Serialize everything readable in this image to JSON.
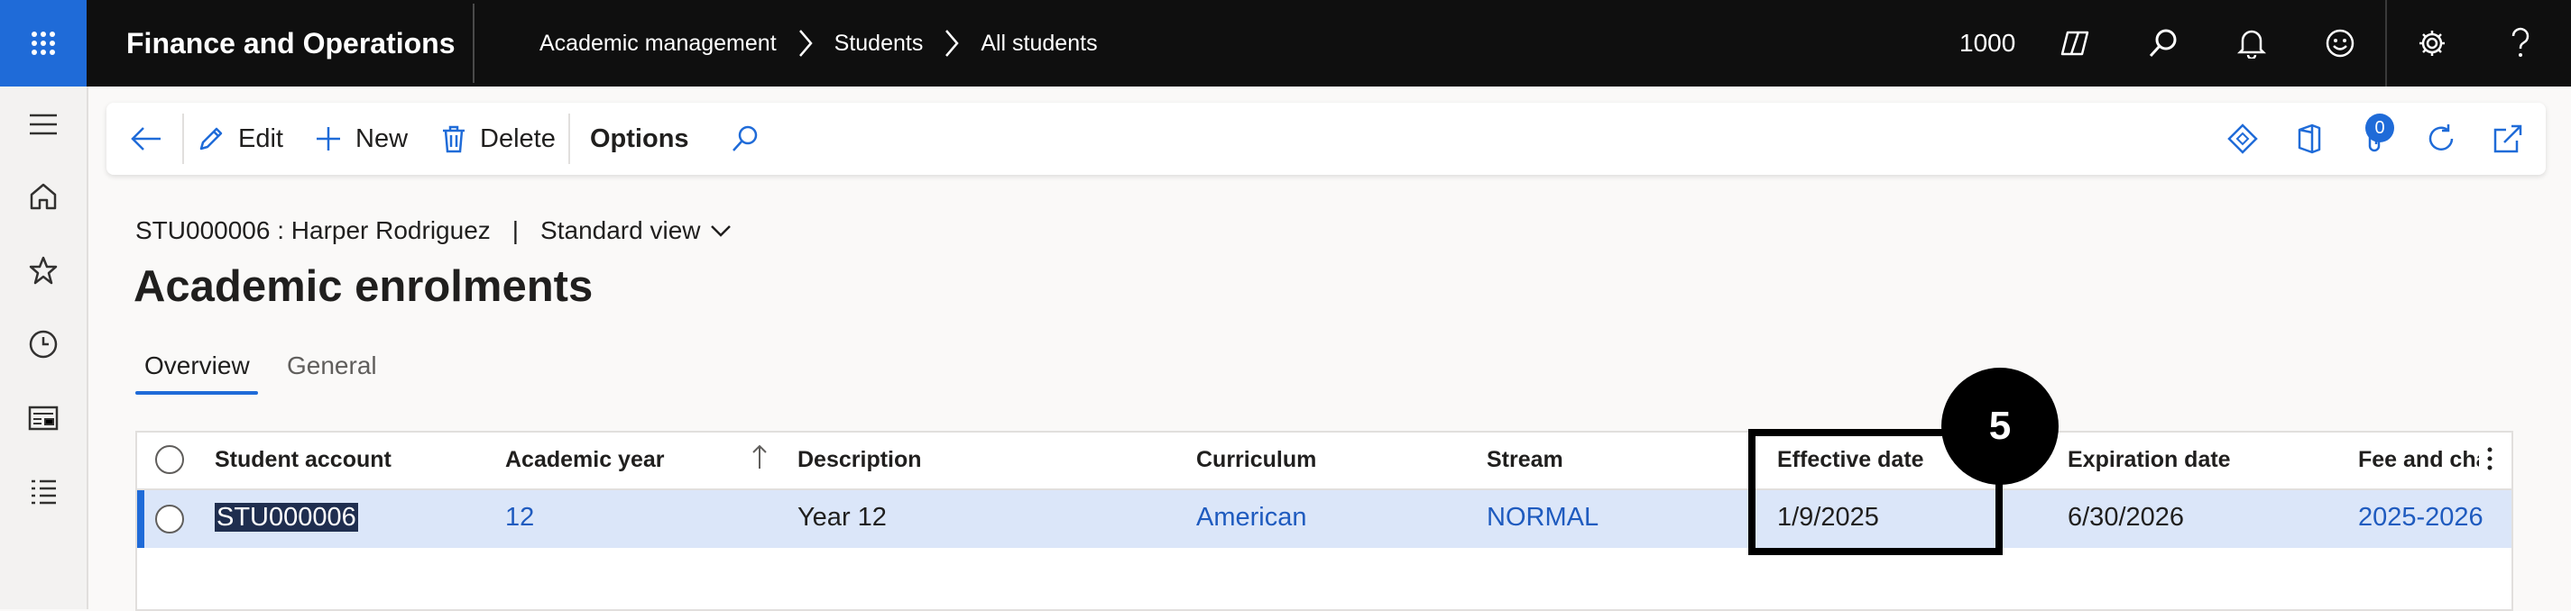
{
  "topbar": {
    "app_title": "Finance and Operations",
    "breadcrumb": [
      "Academic management",
      "Students",
      "All students"
    ],
    "breadcrumb_separator": ">",
    "company": "1000"
  },
  "actionpane": {
    "edit_label": "Edit",
    "new_label": "New",
    "delete_label": "Delete",
    "options_label": "Options",
    "attachments_count": "0"
  },
  "header": {
    "record_id_name": "STU000006 : Harper Rodriguez",
    "pipe": "|",
    "view_name": "Standard view",
    "page_title": "Academic enrolments"
  },
  "tabs": {
    "overview": "Overview",
    "general": "General"
  },
  "grid": {
    "columns": [
      "Student account",
      "Academic year",
      "Description",
      "Curriculum",
      "Stream",
      "Effective date",
      "Expiration date",
      "Fee and char"
    ],
    "rows": [
      {
        "student_account": "STU000006",
        "academic_year": "12",
        "description": "Year 12",
        "curriculum": "American",
        "stream": "NORMAL",
        "effective_date": "1/9/2025",
        "expiration_date": "6/30/2026",
        "fee": "2025-2026"
      }
    ]
  },
  "annotation": {
    "step_number": "5"
  },
  "colors": {
    "accent": "#1f6bd8",
    "topbar": "#0f0f0f",
    "selected_row": "#dbe6f9",
    "link": "#1f5bbf"
  }
}
